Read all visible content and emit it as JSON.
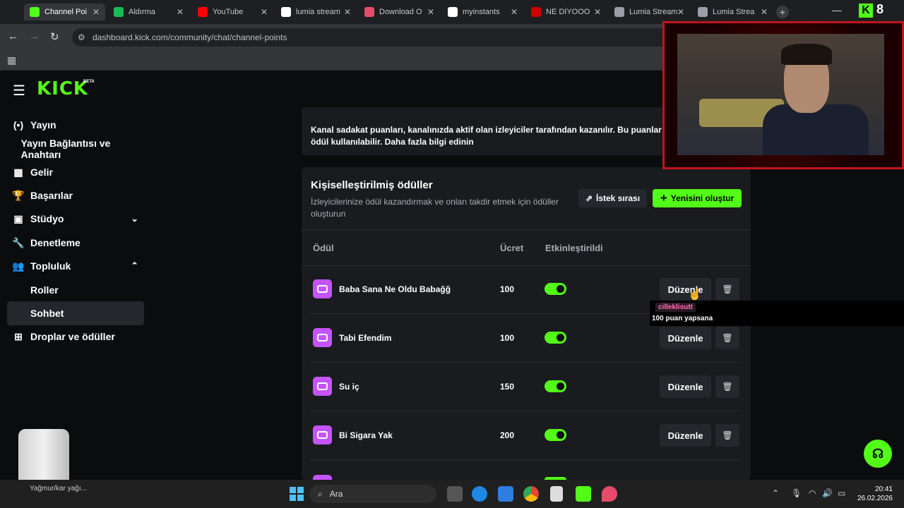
{
  "browser": {
    "tabs": [
      {
        "title": "Channel Poi",
        "active": true,
        "favicon_color": "#53fc18"
      },
      {
        "title": "Aldırma",
        "active": false,
        "favicon_color": "#1db954"
      },
      {
        "title": "YouTube",
        "active": false,
        "favicon_color": "#ff0000"
      },
      {
        "title": "lumia stream",
        "active": false,
        "favicon_color": "#ffffff"
      },
      {
        "title": "Download O",
        "active": false,
        "favicon_color": "#e84b6a"
      },
      {
        "title": "myinstants",
        "active": false,
        "favicon_color": "#ffffff"
      },
      {
        "title": "NE DİYOOO",
        "active": false,
        "favicon_color": "#d10000"
      },
      {
        "title": "Lumia Stream",
        "active": false,
        "favicon_color": "#9aa0a6"
      },
      {
        "title": "Lumia Strea",
        "active": false,
        "favicon_color": "#9aa0a6"
      }
    ],
    "url": "dashboard.kick.com/community/chat/channel-points"
  },
  "brand": {
    "logo": "KICK",
    "beta": "BETA",
    "badge_k": "K",
    "badge_num": "8"
  },
  "sidebar": {
    "items": [
      {
        "label": "Yayın",
        "icon": "broadcast-icon",
        "glyph": "(•)"
      },
      {
        "label": "Yayın Bağlantısı ve Anahtarı",
        "icon": "",
        "glyph": ""
      },
      {
        "label": "Gelir",
        "icon": "chart-icon",
        "glyph": "▦"
      },
      {
        "label": "Başarılar",
        "icon": "trophy-icon",
        "glyph": "🏆"
      },
      {
        "label": "Stüdyo",
        "icon": "studio-icon",
        "glyph": "▣",
        "chevron": "⌄"
      },
      {
        "label": "Denetleme",
        "icon": "wrench-icon",
        "glyph": "🔧"
      },
      {
        "label": "Topluluk",
        "icon": "community-icon",
        "glyph": "👥",
        "chevron": "⌃"
      },
      {
        "label": "Roller",
        "icon": "",
        "glyph": ""
      },
      {
        "label": "Sohbet",
        "icon": "",
        "glyph": "",
        "selected": true
      },
      {
        "label": "Droplar ve ödüller",
        "icon": "gift-icon",
        "glyph": "⊞"
      }
    ]
  },
  "info": {
    "text": "Kanal sadakat puanları, kanalınızda aktif olan izleyiciler tarafından kazanılır. Bu puanlar ödül kullanılabilir. Daha fazla bilgi edinin"
  },
  "rewards_card": {
    "title": "Kişiselleştirilmiş ödüller",
    "subtitle": "İzleyicilerinize ödül kazandırmak ve onları takdir etmek için ödüller oluşturun",
    "queue_label": "İstek sırası",
    "create_label": "Yenisini oluştur",
    "columns": {
      "reward": "Ödül",
      "cost": "Ücret",
      "enabled": "Etkinleştirildi"
    },
    "rows": [
      {
        "name": "Baba Sana Ne Oldu Babağğ",
        "cost": "100",
        "enabled": true,
        "edit": "Düzenle"
      },
      {
        "name": "Tabi Efendim",
        "cost": "100",
        "enabled": true,
        "edit": "Düzenle"
      },
      {
        "name": "Su iç",
        "cost": "150",
        "enabled": true,
        "edit": "Düzenle"
      },
      {
        "name": "Bi Sigara Yak",
        "cost": "200",
        "enabled": true,
        "edit": "Düzenle"
      }
    ]
  },
  "tooltip": {
    "user": "cilleklisutt",
    "message": "100 puan yapsana"
  },
  "taskbar": {
    "weather": "Yağmur/kar yağı...",
    "search_placeholder": "Ara",
    "time": "20:41",
    "date": "26.02.2026"
  },
  "colors": {
    "accent": "#53fc18",
    "reward_icon": "#c454ff",
    "card_bg": "#191b1f"
  }
}
